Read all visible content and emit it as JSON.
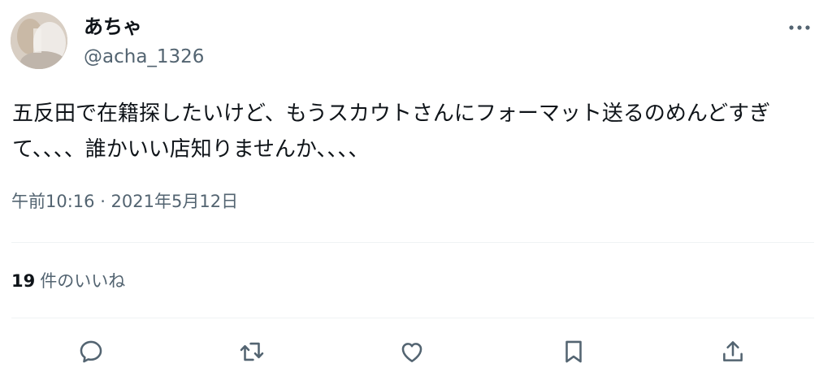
{
  "tweet": {
    "author": {
      "display_name": "あちゃ",
      "handle": "@acha_1326"
    },
    "text": "五反田で在籍探したいけど、もうスカウトさんにフォーマット送るのめんどすぎて、、、、誰かいい店知りませんか、、、、",
    "timestamp": "午前10:16 · 2021年5月12日",
    "likes": {
      "count": "19",
      "label": "件のいいね"
    }
  },
  "icons": {
    "more": "more-horizontal-icon",
    "reply": "reply-icon",
    "retweet": "retweet-icon",
    "like": "heart-icon",
    "bookmark": "bookmark-icon",
    "share": "share-icon"
  },
  "colors": {
    "text_primary": "#0f1419",
    "text_secondary": "#536471",
    "divider": "#eff3f4"
  }
}
